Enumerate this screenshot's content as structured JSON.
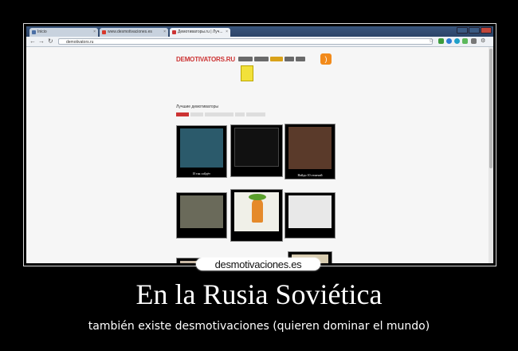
{
  "poster": {
    "title": "En la Rusia Soviética",
    "subtitle": "también existe desmotivaciones (quieren dominar el mundo)",
    "watermark": "desmotivaciones.es"
  },
  "browser": {
    "tabs": [
      {
        "label": "Inicio",
        "active": false,
        "favicon_color": "#4a6fa5"
      },
      {
        "label": "www.desmotivaciones.es",
        "active": false,
        "favicon_color": "#d8382b"
      },
      {
        "label": "Демотиваторы.ru | Луч...",
        "active": true,
        "favicon_color": "#c33"
      }
    ],
    "address": "demotivators.ru",
    "nav_icons": [
      "back-arrow-icon",
      "forward-arrow-icon",
      "reload-icon"
    ],
    "extension_colors": [
      "#3c9b3c",
      "#2d7bd6",
      "#1fa0c8",
      "#5cb85c",
      "#7a7a7a"
    ]
  },
  "site": {
    "logo": "DEMOTIVATORS.RU",
    "section_title": "Лучшие демотиваторы",
    "accent": "#c33"
  },
  "cards": [
    {
      "caption": "И так сойдёт",
      "img_color": "#2b5a6b"
    },
    {
      "caption": "",
      "img_color": "#111"
    },
    {
      "caption": "Найди 10 отличий",
      "img_color": "#5a3a2a"
    },
    {
      "caption": "",
      "img_color": "#6a6a5a"
    },
    {
      "caption": "",
      "img_color": "#f0f0e8"
    },
    {
      "caption": "",
      "img_color": "#e8e8e8"
    },
    {
      "caption": "",
      "img_color": "#c9b9a5"
    },
    {
      "caption": "",
      "img_color": "#dfe6ef"
    },
    {
      "caption": "",
      "img_color": "#d8ccb0"
    }
  ]
}
